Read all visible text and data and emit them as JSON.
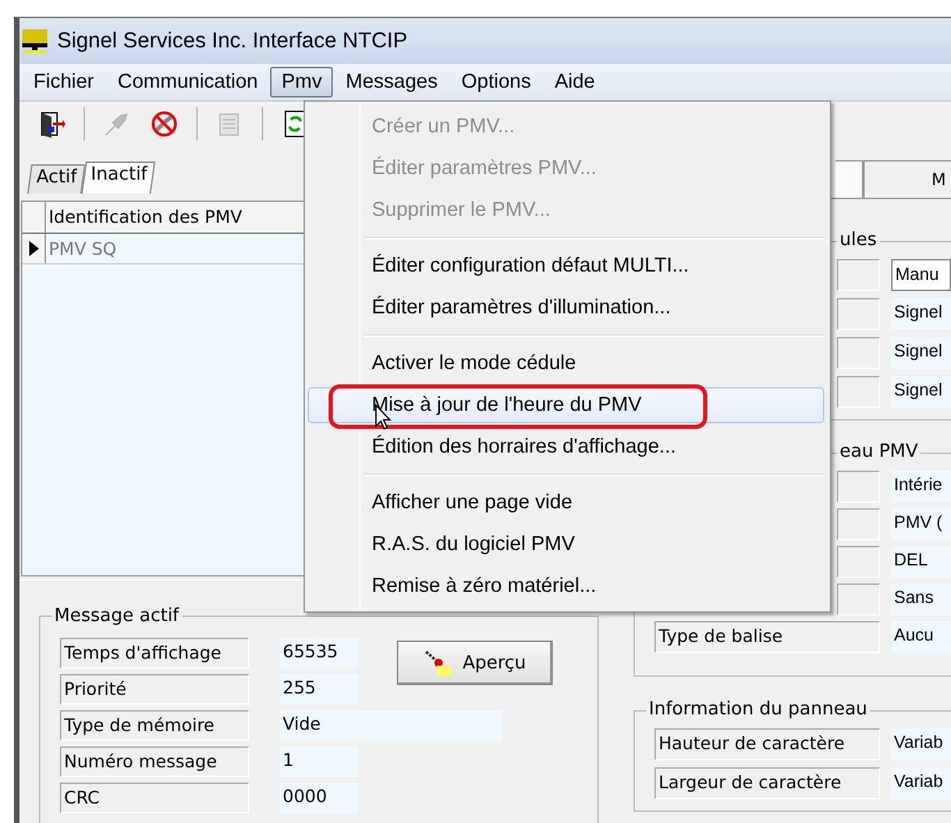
{
  "window": {
    "title": "Signel Services Inc. Interface NTCIP"
  },
  "menu_bar": [
    {
      "label": "Fichier",
      "selected": false
    },
    {
      "label": "Communication",
      "selected": false
    },
    {
      "label": "Pmv",
      "selected": true
    },
    {
      "label": "Messages",
      "selected": false
    },
    {
      "label": "Options",
      "selected": false
    },
    {
      "label": "Aide",
      "selected": false
    }
  ],
  "toolbar": [
    {
      "kind": "exit",
      "disabled": false
    },
    {
      "kind": "plug",
      "disabled": true
    },
    {
      "kind": "disconnect",
      "disabled": false
    },
    {
      "kind": "document",
      "disabled": true
    },
    {
      "kind": "refresh",
      "disabled": false
    }
  ],
  "dropdown": {
    "groups": [
      [
        {
          "label": "Créer un PMV...",
          "disabled": true,
          "selected": false,
          "annotated": false
        },
        {
          "label": "Éditer paramètres PMV...",
          "disabled": true,
          "selected": false,
          "annotated": false
        },
        {
          "label": "Supprimer le PMV...",
          "disabled": true,
          "selected": false,
          "annotated": false
        }
      ],
      [
        {
          "label": "Éditer configuration défaut MULTI...",
          "disabled": false,
          "selected": false,
          "annotated": false
        },
        {
          "label": "Éditer paramètres d'illumination...",
          "disabled": false,
          "selected": false,
          "annotated": false
        }
      ],
      [
        {
          "label": "Activer le mode cédule",
          "disabled": false,
          "selected": false,
          "annotated": false
        },
        {
          "label": "Mise à jour de l'heure du PMV",
          "disabled": false,
          "selected": true,
          "annotated": true
        },
        {
          "label": "Édition des horraires d'affichage...",
          "disabled": false,
          "selected": false,
          "annotated": false
        }
      ],
      [
        {
          "label": "Afficher une page vide",
          "disabled": false,
          "selected": false,
          "annotated": false
        },
        {
          "label": "R.A.S. du logiciel PMV",
          "disabled": false,
          "selected": false,
          "annotated": false
        },
        {
          "label": "Remise à zéro matériel...",
          "disabled": false,
          "selected": false,
          "annotated": false
        }
      ]
    ]
  },
  "left_panel": {
    "tabs": [
      {
        "label": "Actif",
        "selected": false
      },
      {
        "label": "Inactif",
        "selected": true
      }
    ],
    "grid": {
      "columns": [
        "Identification des PMV"
      ],
      "rows": [
        {
          "cells": [
            "PMV SQ"
          ],
          "selected": true
        }
      ]
    }
  },
  "message_actif": {
    "title": "Message actif",
    "fields": [
      {
        "label": "Temps d'affichage",
        "value": "65535"
      },
      {
        "label": "Priorité",
        "value": "255"
      },
      {
        "label": "Type de mémoire",
        "value": "Vide"
      },
      {
        "label": "Numéro message",
        "value": "1"
      },
      {
        "label": "CRC",
        "value": "0000"
      }
    ],
    "button": "Aperçu"
  },
  "right_panel": {
    "tab": "M",
    "groups": [
      {
        "legend": "ules",
        "rows": [
          {
            "value": "Manu",
            "kind": "combo"
          },
          {
            "value": "Signel",
            "kind": "text"
          },
          {
            "value": "Signel",
            "kind": "text"
          },
          {
            "value": "Signel",
            "kind": "text"
          }
        ]
      },
      {
        "legend": "eau PMV",
        "rows": [
          {
            "value": "Intérie",
            "kind": "text"
          },
          {
            "value": "PMV (",
            "kind": "text"
          },
          {
            "value": "DEL",
            "kind": "text"
          },
          {
            "value": "Sans",
            "kind": "text"
          },
          {
            "label": "Type de balise",
            "value": "Aucu",
            "kind": "text"
          }
        ]
      },
      {
        "legend": "Information du panneau",
        "rows": [
          {
            "label": "Hauteur de caractère",
            "value": "Variab",
            "kind": "text"
          },
          {
            "label": "Largeur de caractère",
            "value": "Variab",
            "kind": "text"
          }
        ]
      }
    ]
  }
}
